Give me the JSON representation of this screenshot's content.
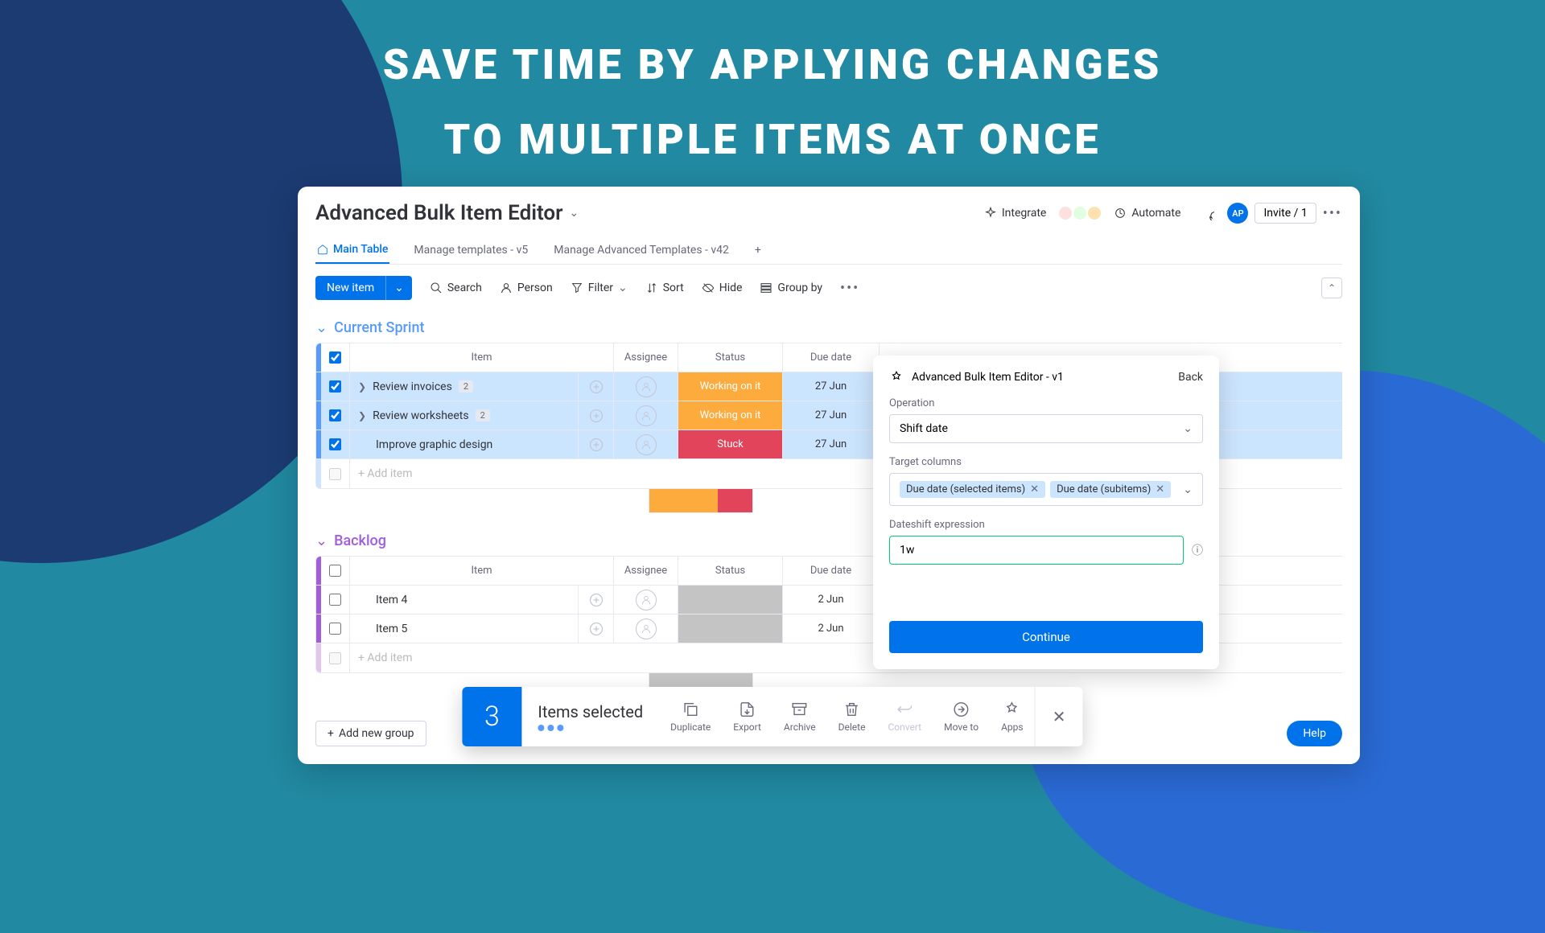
{
  "hero": {
    "line1": "SAVE TIME BY APPLYING CHANGES",
    "line2": "TO MULTIPLE ITEMS AT ONCE"
  },
  "header": {
    "title": "Advanced Bulk Item Editor",
    "integrate": "Integrate",
    "automate": "Automate",
    "avatar": "AP",
    "invite": "Invite / 1"
  },
  "tabs": {
    "main": "Main Table",
    "t2": "Manage templates - v5",
    "t3": "Manage Advanced Templates - v42"
  },
  "toolbar": {
    "new": "New item",
    "search": "Search",
    "person": "Person",
    "filter": "Filter",
    "sort": "Sort",
    "hide": "Hide",
    "group": "Group by"
  },
  "cols": {
    "item": "Item",
    "assignee": "Assignee",
    "status": "Status",
    "date": "Due date"
  },
  "g1": {
    "title": "Current Sprint",
    "rows": [
      {
        "name": "Review invoices",
        "badge": "2",
        "status": "Working on it",
        "sclass": "s-working",
        "date": "27 Jun"
      },
      {
        "name": "Review worksheets",
        "badge": "2",
        "status": "Working on it",
        "sclass": "s-working",
        "date": "27 Jun"
      },
      {
        "name": "Improve graphic design",
        "badge": "",
        "status": "Stuck",
        "sclass": "s-stuck",
        "date": "27 Jun"
      }
    ],
    "add": "+ Add item"
  },
  "g2": {
    "title": "Backlog",
    "rows": [
      {
        "name": "Item 4",
        "date": "2 Jun"
      },
      {
        "name": "Item 5",
        "date": "2 Jun"
      }
    ],
    "add": "+ Add item"
  },
  "panel": {
    "title": "Advanced Bulk Item Editor - v1",
    "back": "Back",
    "op_label": "Operation",
    "op_value": "Shift date",
    "tc_label": "Target columns",
    "chip1": "Due date (selected items)",
    "chip2": "Due date (subitems)",
    "ex_label": "Dateshift expression",
    "ex_value": "1w",
    "continue": "Continue"
  },
  "footer": {
    "count": "3",
    "selected": "Items selected",
    "duplicate": "Duplicate",
    "export": "Export",
    "archive": "Archive",
    "delete": "Delete",
    "convert": "Convert",
    "move": "Move to",
    "apps": "Apps"
  },
  "addgroup": "Add new group",
  "help": "Help"
}
